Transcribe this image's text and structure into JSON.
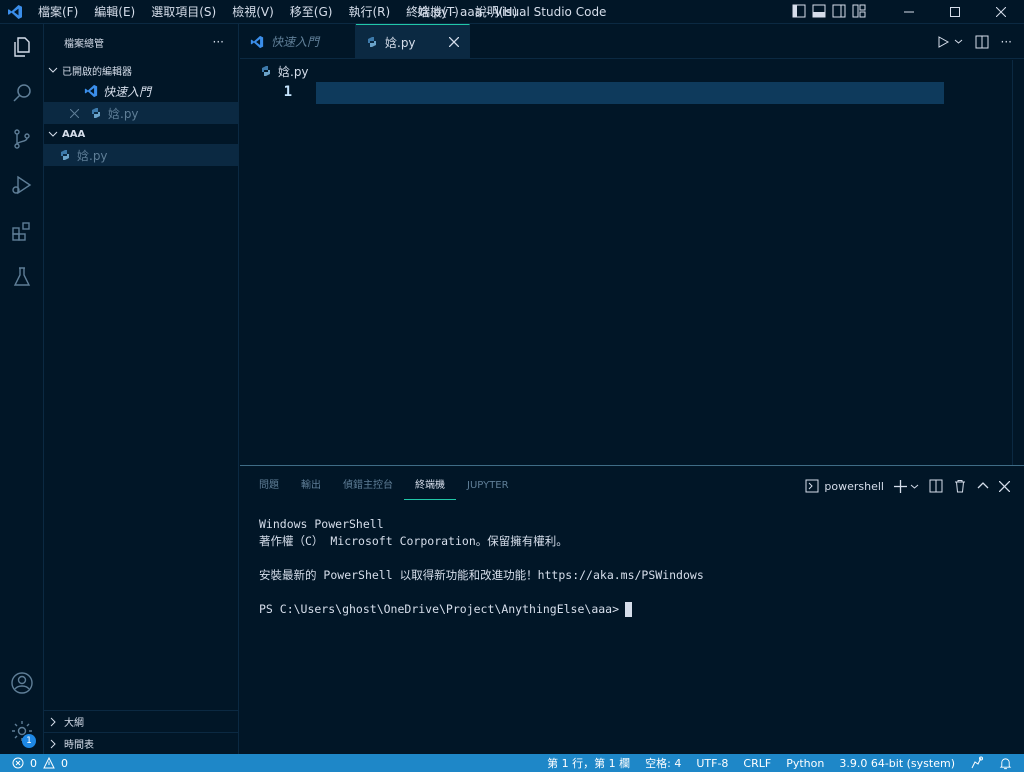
{
  "window": {
    "title": "娢.py - aaa - Visual Studio Code",
    "menu": [
      "檔案(F)",
      "編輯(E)",
      "選取項目(S)",
      "檢視(V)",
      "移至(G)",
      "執行(R)",
      "終端機(T)",
      "說明(H)"
    ]
  },
  "sidebar": {
    "header": "檔案總管",
    "more": "···",
    "open_editors_title": "已開啟的編輯器",
    "open_editors": [
      {
        "label": "快速入門"
      },
      {
        "label": "娢.py"
      }
    ],
    "folder_title": "AAA",
    "files": [
      {
        "label": "娢.py"
      }
    ],
    "outline": "大綱",
    "timeline": "時間表",
    "settings_badge": "1"
  },
  "editor": {
    "tabs": [
      {
        "label": "快速入門"
      },
      {
        "label": "娢.py"
      }
    ],
    "breadcrumb": "娢.py",
    "line_number": "1"
  },
  "panel": {
    "tabs": [
      "問題",
      "輸出",
      "偵錯主控台",
      "終端機",
      "JUPYTER"
    ],
    "shell": "powershell",
    "terminal_lines": [
      "Windows PowerShell",
      "著作權（C） Microsoft Corporation。保留擁有權利。",
      "",
      "安裝最新的 PowerShell 以取得新功能和改進功能！https://aka.ms/PSWindows",
      "",
      "PS C:\\Users\\ghost\\OneDrive\\Project\\AnythingElse\\aaa>"
    ]
  },
  "status": {
    "errors": "0",
    "warnings": "0",
    "position": "第 1 行，第 1 欄",
    "spaces": "空格: 4",
    "encoding": "UTF-8",
    "eol": "CRLF",
    "language": "Python",
    "interpreter": "3.9.0 64-bit (system)"
  },
  "colors": {
    "background": "#011627",
    "accent": "#21c7a8",
    "statusbar": "#1e87c8",
    "vscode_blue": "#3b8eea"
  }
}
